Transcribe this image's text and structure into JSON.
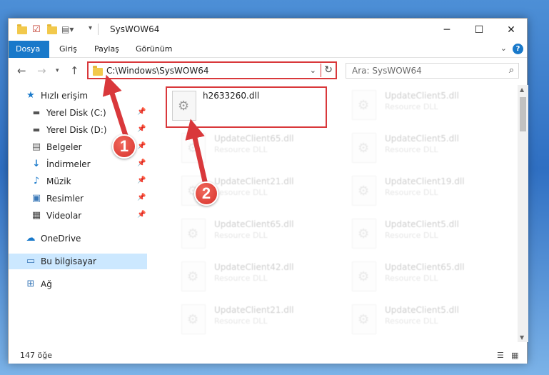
{
  "window": {
    "title": "SysWOW64",
    "controls": {
      "minimize": "─",
      "maximize": "☐",
      "close": "✕"
    }
  },
  "ribbon": {
    "tabs": [
      {
        "label": "Dosya",
        "active": true
      },
      {
        "label": "Giriş",
        "active": false
      },
      {
        "label": "Paylaş",
        "active": false
      },
      {
        "label": "Görünüm",
        "active": false
      }
    ],
    "help": "?"
  },
  "address": {
    "path": "C:\\Windows\\SysWOW64",
    "search_placeholder": "Ara: SysWOW64"
  },
  "sidebar": {
    "items": [
      {
        "label": "Hızlı erişim",
        "icon": "star-icon",
        "pinned": false
      },
      {
        "label": "Yerel Disk (C:)",
        "icon": "drive-icon",
        "pinned": true
      },
      {
        "label": "Yerel Disk (D:)",
        "icon": "drive-icon",
        "pinned": true
      },
      {
        "label": "Belgeler",
        "icon": "documents-icon",
        "pinned": true
      },
      {
        "label": "İndirmeler",
        "icon": "download-icon",
        "pinned": true
      },
      {
        "label": "Müzik",
        "icon": "music-icon",
        "pinned": true
      },
      {
        "label": "Resimler",
        "icon": "pictures-icon",
        "pinned": true
      },
      {
        "label": "Videolar",
        "icon": "video-icon",
        "pinned": true
      },
      {
        "label": "OneDrive",
        "icon": "cloud-icon",
        "pinned": false
      },
      {
        "label": "Bu bilgisayar",
        "icon": "computer-icon",
        "pinned": false,
        "selected": true
      },
      {
        "label": "Ağ",
        "icon": "network-icon",
        "pinned": false
      }
    ]
  },
  "files": {
    "highlighted": {
      "name": "h2633260.dll"
    },
    "left_column": [
      {
        "name": "UpdateClient65.dll",
        "type": "Resource DLL"
      },
      {
        "name": "UpdateClient21.dll",
        "type": "Resource DLL"
      },
      {
        "name": "UpdateClient65.dll",
        "type": "Resource DLL"
      },
      {
        "name": "UpdateClient42.dll",
        "type": "Resource DLL"
      },
      {
        "name": "UpdateClient21.dll",
        "type": "Resource DLL"
      }
    ],
    "right_column": [
      {
        "name": "UpdateClient5.dll",
        "type": "Resource DLL"
      },
      {
        "name": "UpdateClient5.dll",
        "type": "Resource DLL"
      },
      {
        "name": "UpdateClient19.dll",
        "type": "Resource DLL"
      },
      {
        "name": "UpdateClient5.dll",
        "type": "Resource DLL"
      },
      {
        "name": "UpdateClient65.dll",
        "type": "Resource DLL"
      },
      {
        "name": "UpdateClient5.dll",
        "type": "Resource DLL"
      }
    ]
  },
  "status": {
    "item_count": "147 öğe"
  },
  "annotations": {
    "step1": "1",
    "step2": "2",
    "color": "#d9383b"
  }
}
